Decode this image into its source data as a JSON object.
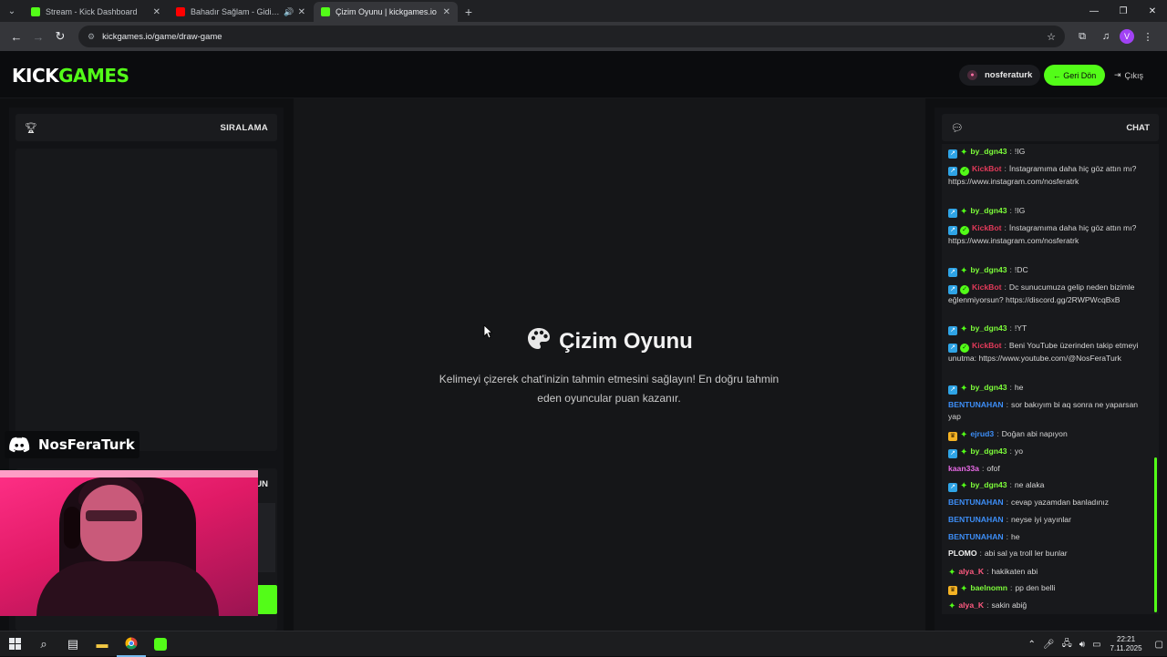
{
  "browser": {
    "tabs": [
      {
        "title": "Stream - Kick Dashboard",
        "favicon_color": "#53fc18",
        "active": false
      },
      {
        "title": "Bahadır Sağlam - Gidiyor Gi",
        "favicon_color": "#ff0000",
        "active": false,
        "audio": true
      },
      {
        "title": "Çizim Oyunu | kickgames.io",
        "favicon_color": "#53fc18",
        "active": true
      }
    ],
    "url": "kickgames.io/game/draw-game",
    "profile_initial": "V"
  },
  "header": {
    "logo_part1": "KICK",
    "logo_part2": "GAMES",
    "username": "nosferaturk",
    "back_label": "← Geri Dön",
    "logout_label": "Çıkış"
  },
  "left": {
    "ranking_title": "SIRALAMA",
    "lower_title": "UN"
  },
  "game": {
    "title": "Çizim Oyunu",
    "description": "Kelimeyi çizerek chat'inizin tahmin etmesini sağlayın! En doğru tahmin eden oyuncular puan kazanır."
  },
  "chat": {
    "title": "CHAT",
    "messages": [
      {
        "badges": [
          "blue",
          "spark"
        ],
        "user": "by_dgn43",
        "color": "u-green",
        "text": "!IG"
      },
      {
        "badges": [
          "blue",
          "green"
        ],
        "user": "KickBot",
        "color": "u-red",
        "text": "İnstagramıma daha hiç göz attın mı? https://www.instagram.com/nosferatrk"
      },
      {
        "badges": [
          "blue",
          "spark"
        ],
        "user": "by_dgn43",
        "color": "u-green",
        "text": "!IG"
      },
      {
        "badges": [
          "blue",
          "green"
        ],
        "user": "KickBot",
        "color": "u-red",
        "text": "İnstagramıma daha hiç göz attın mı? https://www.instagram.com/nosferatrk"
      },
      {
        "badges": [
          "blue",
          "spark"
        ],
        "user": "by_dgn43",
        "color": "u-green",
        "text": "!DC"
      },
      {
        "badges": [
          "blue",
          "green"
        ],
        "user": "KickBot",
        "color": "u-red",
        "text": "Dc sunucumuza gelip neden bizimle eğlenmiyorsun? https://discord.gg/2RWPWcqBxB"
      },
      {
        "badges": [
          "blue",
          "spark"
        ],
        "user": "by_dgn43",
        "color": "u-green",
        "text": "!YT"
      },
      {
        "badges": [
          "blue",
          "green"
        ],
        "user": "KickBot",
        "color": "u-red",
        "text": "Beni YouTube üzerinden takip etmeyi unutma: https://www.youtube.com/@NosFeraTurk"
      },
      {
        "badges": [
          "blue",
          "spark"
        ],
        "user": "by_dgn43",
        "color": "u-green",
        "text": "he"
      },
      {
        "badges": [],
        "user": "BENTUNAHAN",
        "color": "u-blue",
        "text": "sor bakıyım bi aq sonra ne yaparsan yap"
      },
      {
        "badges": [
          "gold",
          "spark"
        ],
        "user": "ejrud3",
        "color": "u-blue",
        "text": "Doğan abi napıyon"
      },
      {
        "badges": [
          "blue",
          "spark"
        ],
        "user": "by_dgn43",
        "color": "u-green",
        "text": "yo"
      },
      {
        "badges": [],
        "user": "kaan33a",
        "color": "u-pink",
        "text": "ofof"
      },
      {
        "badges": [
          "blue",
          "spark"
        ],
        "user": "by_dgn43",
        "color": "u-green",
        "text": "ne alaka"
      },
      {
        "badges": [],
        "user": "BENTUNAHAN",
        "color": "u-blue",
        "text": "cevap yazamdan banladınız"
      },
      {
        "badges": [],
        "user": "BENTUNAHAN",
        "color": "u-blue",
        "text": "neyse iyi yayınlar"
      },
      {
        "badges": [],
        "user": "BENTUNAHAN",
        "color": "u-blue",
        "text": "he"
      },
      {
        "badges": [],
        "user": "PLOMO",
        "color": "u-white",
        "text": "abi sal ya troll ler bunlar"
      },
      {
        "badges": [
          "spark"
        ],
        "user": "alya_K",
        "color": "u-rose",
        "text": "hakikaten abi"
      },
      {
        "badges": [
          "gold",
          "spark"
        ],
        "user": "baelnomn",
        "color": "u-green",
        "text": "pp den belli"
      },
      {
        "badges": [
          "spark"
        ],
        "user": "alya_K",
        "color": "u-rose",
        "text": "sakin abiğ"
      }
    ]
  },
  "overlay": {
    "discord_name": "NosFeraTurk"
  },
  "taskbar": {
    "time": "22:21",
    "date": "7.11.2025"
  }
}
